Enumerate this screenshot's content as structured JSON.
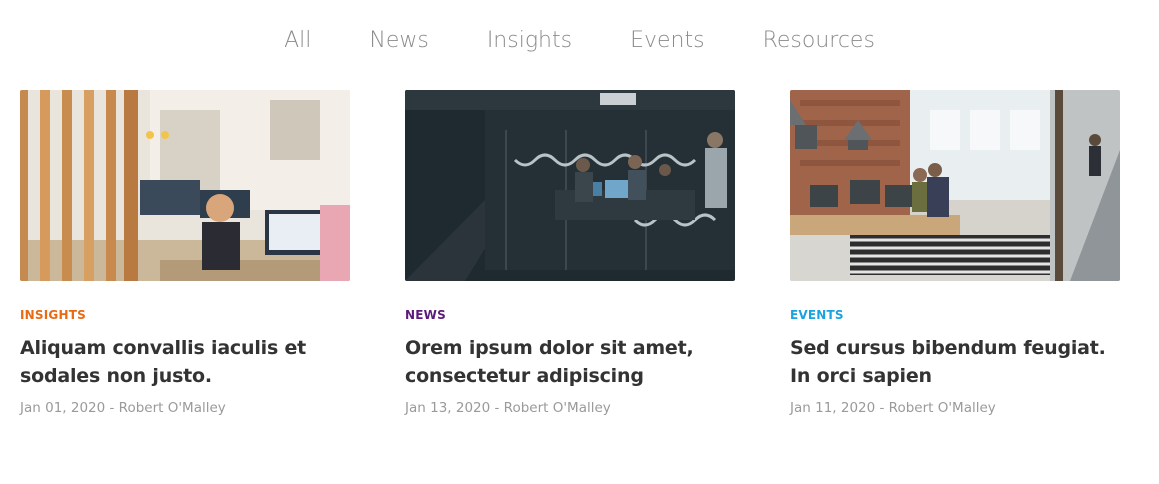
{
  "filters": [
    "All",
    "News",
    "Insights",
    "Events",
    "Resources"
  ],
  "cards": [
    {
      "category": "INSIGHTS",
      "category_color": "#e86a12",
      "title": "Aliquam convallis iaculis et sodales non justo.",
      "meta": "Jan 01, 2020 - Robert O'Malley",
      "image": "bright-office-photo"
    },
    {
      "category": "NEWS",
      "category_color": "#5c1a7a",
      "title": "Orem ipsum dolor sit amet, consectetur adipiscing",
      "meta": "Jan 13, 2020 - Robert O'Malley",
      "image": "dark-meeting-room-photo"
    },
    {
      "category": "EVENTS",
      "category_color": "#19a3e0",
      "title": "Sed cursus bibendum feugiat. In orci sapien",
      "meta": "Jan 11, 2020 - Robert O'Malley",
      "image": "loft-office-photo"
    }
  ]
}
